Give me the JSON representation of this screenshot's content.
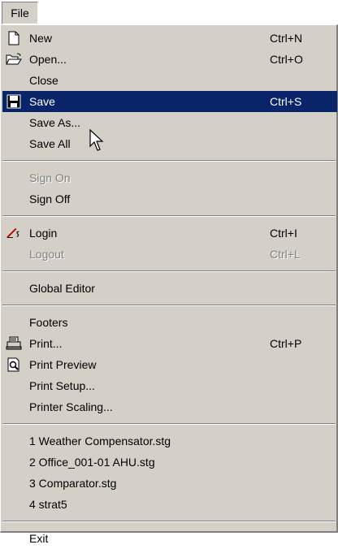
{
  "menubar": {
    "file_label": "File"
  },
  "menu": {
    "items": {
      "new": {
        "label": "New",
        "shortcut": "Ctrl+N"
      },
      "open": {
        "label": "Open...",
        "shortcut": "Ctrl+O"
      },
      "close": {
        "label": "Close"
      },
      "save": {
        "label": "Save",
        "shortcut": "Ctrl+S"
      },
      "save_as": {
        "label": "Save As..."
      },
      "save_all": {
        "label": "Save All"
      },
      "sign_on": {
        "label": "Sign On"
      },
      "sign_off": {
        "label": "Sign Off"
      },
      "login": {
        "label": "Login",
        "shortcut": "Ctrl+I"
      },
      "logout": {
        "label": "Logout",
        "shortcut": "Ctrl+L"
      },
      "global_editor": {
        "label": "Global Editor"
      },
      "footers": {
        "label": "Footers"
      },
      "print": {
        "label": "Print...",
        "shortcut": "Ctrl+P"
      },
      "print_preview": {
        "label": "Print Preview"
      },
      "print_setup": {
        "label": "Print Setup..."
      },
      "printer_scaling": {
        "label": "Printer Scaling..."
      },
      "recent_1": {
        "label": "1 Weather Compensator.stg"
      },
      "recent_2": {
        "label": "2 Office_001-01 AHU.stg"
      },
      "recent_3": {
        "label": "3 Comparator.stg"
      },
      "recent_4": {
        "label": "4 strat5"
      },
      "exit": {
        "label": "Exit"
      }
    },
    "highlighted": "Save",
    "disabled": [
      "Sign On",
      "Logout"
    ]
  },
  "colors": {
    "menu_bg": "#d4d0c8",
    "highlight_bg": "#0a246a",
    "highlight_text": "#ffffff",
    "disabled_text": "#808080"
  },
  "icons": [
    "new-document-icon",
    "open-folder-icon",
    "save-floppy-icon",
    "login-key-icon",
    "printer-icon",
    "print-preview-icon",
    "mouse-cursor-icon"
  ]
}
